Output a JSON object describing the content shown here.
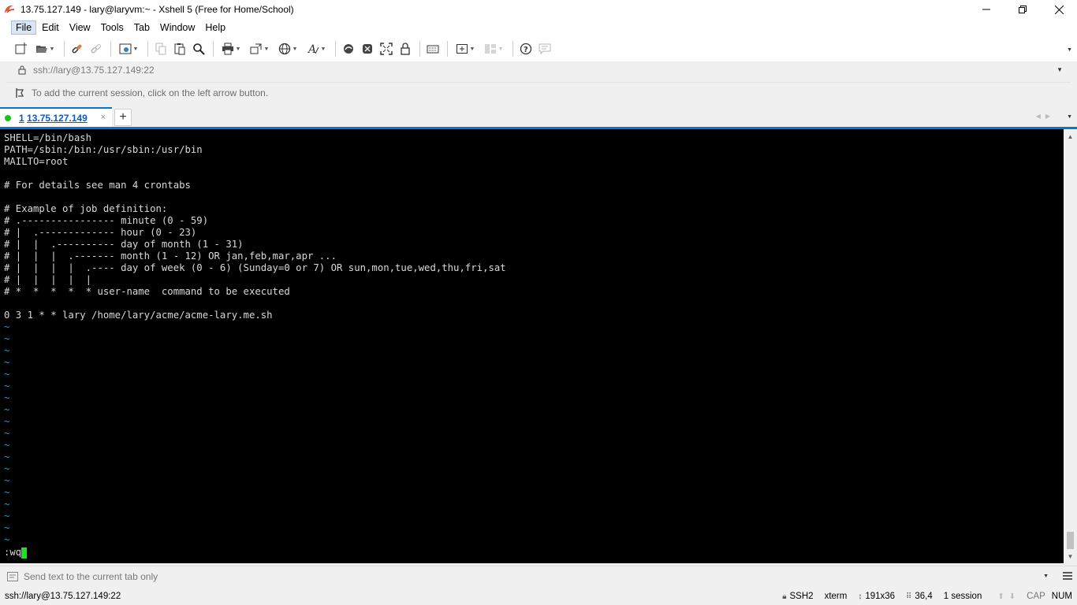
{
  "window": {
    "title": "13.75.127.149 - lary@laryvm:~ - Xshell 5 (Free for Home/School)"
  },
  "menu": [
    {
      "label": "File",
      "name": "menu-file"
    },
    {
      "label": "Edit",
      "name": "menu-edit"
    },
    {
      "label": "View",
      "name": "menu-view"
    },
    {
      "label": "Tools",
      "name": "menu-tools"
    },
    {
      "label": "Tab",
      "name": "menu-tab"
    },
    {
      "label": "Window",
      "name": "menu-window"
    },
    {
      "label": "Help",
      "name": "menu-help"
    }
  ],
  "address": {
    "value": "ssh://lary@13.75.127.149:22"
  },
  "hint": {
    "text": "To add the current session, click on the left arrow button."
  },
  "tab": {
    "number": "1",
    "label": "13.75.127.149",
    "close": "×",
    "add": "+"
  },
  "terminal": {
    "lines": [
      "SHELL=/bin/bash",
      "PATH=/sbin:/bin:/usr/sbin:/usr/bin",
      "MAILTO=root",
      "",
      "# For details see man 4 crontabs",
      "",
      "# Example of job definition:",
      "# .---------------- minute (0 - 59)",
      "# |  .------------- hour (0 - 23)",
      "# |  |  .---------- day of month (1 - 31)",
      "# |  |  |  .------- month (1 - 12) OR jan,feb,mar,apr ...",
      "# |  |  |  |  .---- day of week (0 - 6) (Sunday=0 or 7) OR sun,mon,tue,wed,thu,fri,sat",
      "# |  |  |  |  |",
      "# *  *  *  *  * user-name  command to be executed",
      "",
      "0 3 1 * * lary /home/lary/acme/acme-lary.me.sh"
    ],
    "tilde_count": 19,
    "tilde": "~",
    "command": ":wq"
  },
  "compose": {
    "placeholder": "Send text to the current tab only"
  },
  "status": {
    "connection": "ssh://lary@13.75.127.149:22",
    "protocol": "SSH2",
    "terminal_type": "xterm",
    "size": "191x36",
    "cursor_pos": "36,4",
    "sessions": "1 session",
    "caps": "CAP",
    "num": "NUM"
  },
  "colors": {
    "accent": "#0078d7",
    "terminal_bg": "#000000",
    "terminal_fg": "#d8d8d8",
    "tilde": "#1c9ad8",
    "cursor": "#1fe11f",
    "session_dot": "#1ec21e"
  },
  "icons": {
    "app": "xshell-logo-icon",
    "lock": "lock-icon",
    "hint": "add-session-arrow-icon"
  }
}
